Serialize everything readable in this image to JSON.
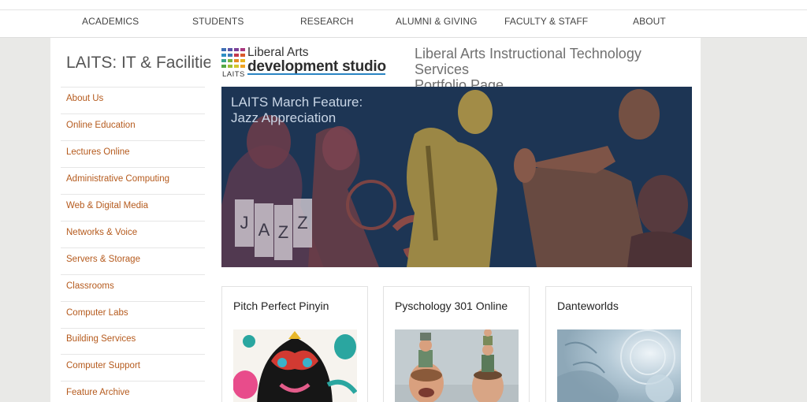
{
  "nav": {
    "items": [
      "ACADEMICS",
      "STUDENTS",
      "RESEARCH",
      "ALUMNI & GIVING",
      "FACULTY & STAFF",
      "ABOUT"
    ]
  },
  "sidebar": {
    "title": "LAITS: IT & Facilities",
    "items": [
      "About Us",
      "Online Education",
      "Lectures Online",
      "Administrative Computing",
      "Web & Digital Media",
      "Networks & Voice",
      "Servers & Storage",
      "Classrooms",
      "Computer Labs",
      "Building Services",
      "Computer Support",
      "Feature Archive"
    ]
  },
  "logo": {
    "line1": "Liberal Arts",
    "line2": "development studio",
    "small": "LAITS"
  },
  "heading": {
    "line1": "Liberal Arts Instructional Technology Services",
    "line2": "Portfolio Page"
  },
  "banner": {
    "line1": "LAITS March Feature:",
    "line2": "Jazz Appreciation",
    "letters": [
      "J",
      "A",
      "Z",
      "Z"
    ]
  },
  "cards": [
    {
      "title": "Pitch Perfect Pinyin"
    },
    {
      "title": "Pyschology 301 Online"
    },
    {
      "title": "Danteworlds"
    }
  ],
  "colors": {
    "link": "#b55a1d",
    "banner_bg": "#1d3554",
    "accent_blue": "#2a84c3"
  }
}
